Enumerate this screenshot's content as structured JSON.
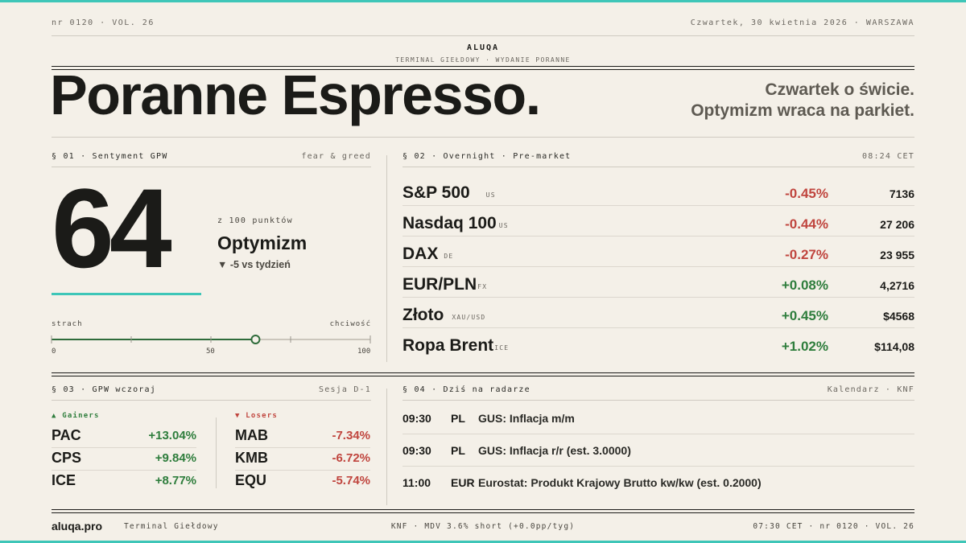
{
  "colors": {
    "accent": "#3ec6b8",
    "positive": "#2e7d3c",
    "negative": "#c0453e",
    "background": "#f4f0e8",
    "ink": "#1b1b18"
  },
  "header": {
    "issue": "nr 0120 · VOL. 26",
    "dateline": "Czwartek, 30 kwietnia 2026 · WARSZAWA",
    "brand": "ALUQA",
    "brand_sub": "TERMINAL GIEŁDOWY · WYDANIE PORANNE",
    "title": "Poranne Espresso.",
    "tagline_1": "Czwartek o świcie.",
    "tagline_2": "Optymizm wraca na parkiet."
  },
  "sentiment": {
    "label": "§ 01 · Sentyment GPW",
    "right_label": "fear & greed",
    "score": "64",
    "score_value": 64,
    "score_of": "z 100 punktów",
    "mood": "Optymizm",
    "change": "▼ -5 vs tydzień",
    "gauge_left": "strach",
    "gauge_right": "chciwość",
    "ticks": [
      "0",
      "50",
      "100"
    ]
  },
  "overnight": {
    "label": "§ 02 · Overnight · Pre-market",
    "time": "08:24 CET",
    "rows": [
      {
        "name": "S&P 500",
        "region": "US",
        "change": "-0.45%",
        "value": "7136",
        "dir": "neg"
      },
      {
        "name": "Nasdaq 100",
        "region": "US",
        "change": "-0.44%",
        "value": "27 206",
        "dir": "neg"
      },
      {
        "name": "DAX",
        "region": "DE",
        "change": "-0.27%",
        "value": "23 955",
        "dir": "neg"
      },
      {
        "name": "EUR/PLN",
        "region": "FX",
        "change": "+0.08%",
        "value": "4,2716",
        "dir": "pos"
      },
      {
        "name": "Złoto",
        "region": "XAU/USD",
        "change": "+0.45%",
        "value": "$4568",
        "dir": "pos"
      },
      {
        "name": "Ropa Brent",
        "region": "ICE",
        "change": "+1.02%",
        "value": "$114,08",
        "dir": "pos"
      }
    ]
  },
  "yesterday": {
    "label": "§ 03 · GPW wczoraj",
    "right_label": "Sesja D-1",
    "gainers_label": "▲ Gainers",
    "losers_label": "▼ Losers",
    "gainers": [
      {
        "ticker": "PAC",
        "change": "+13.04%"
      },
      {
        "ticker": "CPS",
        "change": "+9.84%"
      },
      {
        "ticker": "ICE",
        "change": "+8.77%"
      }
    ],
    "losers": [
      {
        "ticker": "MAB",
        "change": "-7.34%"
      },
      {
        "ticker": "KMB",
        "change": "-6.72%"
      },
      {
        "ticker": "EQU",
        "change": "-5.74%"
      }
    ]
  },
  "radar": {
    "label": "§ 04 · Dziś na radarze",
    "right_label": "Kalendarz · KNF",
    "events": [
      {
        "time": "09:30",
        "country": "PL",
        "event": "GUS: Inflacja m/m"
      },
      {
        "time": "09:30",
        "country": "PL",
        "event": "GUS: Inflacja r/r (est. 3.0000)"
      },
      {
        "time": "11:00",
        "country": "EUR",
        "event": "Eurostat: Produkt Krajowy Brutto kw/kw (est. 0.2000)"
      }
    ]
  },
  "footer": {
    "brand": "aluqa.pro",
    "sub": "Terminal Giełdowy",
    "mid": "KNF · MDV 3.6% short (+0.0pp/tyg)",
    "right": "07:30 CET · nr 0120 · VOL. 26"
  }
}
